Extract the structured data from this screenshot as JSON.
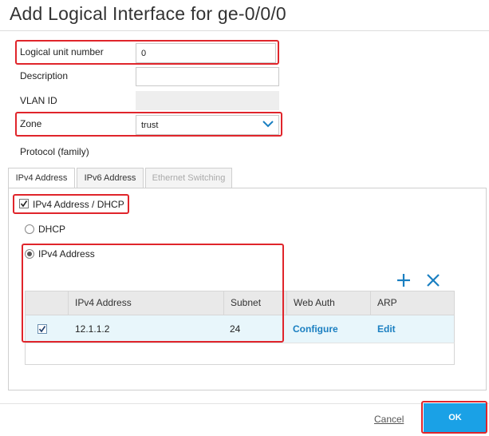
{
  "dialog": {
    "title": "Add Logical Interface for ge-0/0/0"
  },
  "form": {
    "logical_unit_label": "Logical unit number",
    "logical_unit_value": "0",
    "description_label": "Description",
    "description_value": "",
    "vlan_id_label": "VLAN ID",
    "zone_label": "Zone",
    "zone_value": "trust",
    "protocol_label": "Protocol (family)"
  },
  "tabs": [
    {
      "label": "IPv4 Address",
      "state": "active"
    },
    {
      "label": "IPv6 Address",
      "state": "normal"
    },
    {
      "label": "Ethernet Switching",
      "state": "disabled"
    }
  ],
  "ipv4": {
    "enable_label": "IPv4 Address / DHCP",
    "enable_checked": true,
    "dhcp_label": "DHCP",
    "static_label": "IPv4 Address",
    "selected": "static"
  },
  "table": {
    "columns": [
      "IPv4 Address",
      "Subnet",
      "Web Auth",
      "ARP"
    ],
    "rows": [
      {
        "checked": true,
        "address": "12.1.1.2",
        "subnet": "24",
        "web_auth": "Configure",
        "arp": "Edit"
      }
    ],
    "add_icon": "plus-icon",
    "delete_icon": "close-icon"
  },
  "footer": {
    "cancel_label": "Cancel",
    "ok_label": "OK"
  },
  "colors": {
    "annotation_red": "#e0252b",
    "accent_blue": "#1aa1e6",
    "link_blue": "#1a7fc1",
    "selected_row": "#e8f6fb"
  }
}
